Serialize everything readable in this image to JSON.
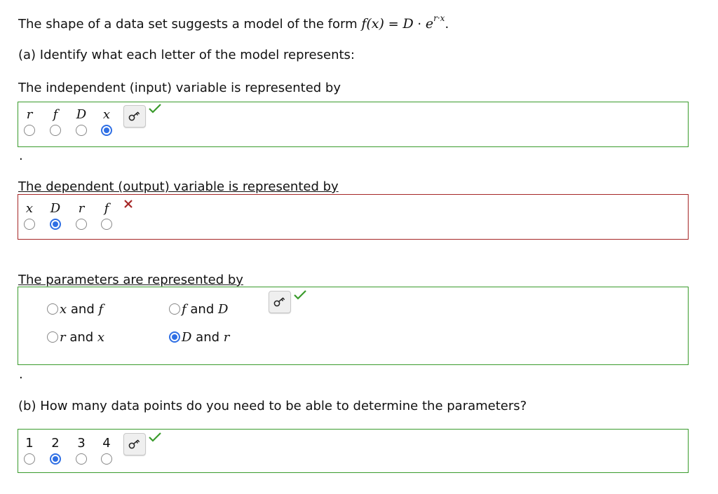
{
  "intro": {
    "prefix": "The shape of a data set suggests a model of the form ",
    "formula_lhs": "f(x)",
    "formula_eq": " = ",
    "formula_D": "D",
    "formula_dot": " · ",
    "formula_e": "e",
    "formula_exp": "r·x",
    "formula_end": "."
  },
  "part_a": {
    "heading": "(a) Identify what each letter of the model represents:"
  },
  "q_independent": {
    "prompt": "The independent (input) variable is represented by",
    "options": [
      "r",
      "f",
      "D",
      "x"
    ],
    "selected": "x",
    "status": "correct",
    "trailing": "."
  },
  "q_dependent": {
    "prompt": "The dependent (output) variable is represented by",
    "options": [
      "x",
      "D",
      "r",
      "f"
    ],
    "selected": "D",
    "status": "incorrect"
  },
  "q_parameters": {
    "prompt": "The parameters are represented by",
    "options": [
      {
        "a": "x",
        "and": " and ",
        "b": "f"
      },
      {
        "a": "f",
        "and": " and ",
        "b": "D"
      },
      {
        "a": "r",
        "and": " and ",
        "b": "x"
      },
      {
        "a": "D",
        "and": " and ",
        "b": "r"
      }
    ],
    "selected": "D and r",
    "status": "correct",
    "trailing": "."
  },
  "part_b": {
    "question": "(b) How many data points do you need to be able to determine the parameters?",
    "options": [
      "1",
      "2",
      "3",
      "4"
    ],
    "selected": "2",
    "status": "correct"
  },
  "icons": {
    "key": "key-icon",
    "check": "check-icon",
    "cross": "cross-icon"
  },
  "colors": {
    "correct": "#3a9b2c",
    "incorrect": "#a52626",
    "selected_radio": "#2f6fe4"
  }
}
